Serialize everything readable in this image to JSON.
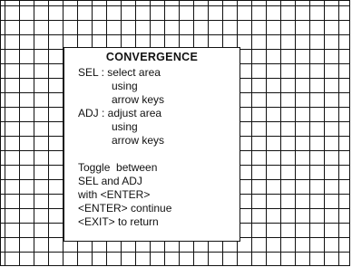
{
  "menu": {
    "title": "CONVERGENCE",
    "lines": [
      "SEL : select area",
      "using",
      "arrow keys",
      "ADJ : adjust area",
      "using",
      "arrow keys",
      "Toggle  between",
      "SEL and ADJ",
      "with <ENTER>",
      "<ENTER> continue",
      "<EXIT> to return"
    ]
  }
}
